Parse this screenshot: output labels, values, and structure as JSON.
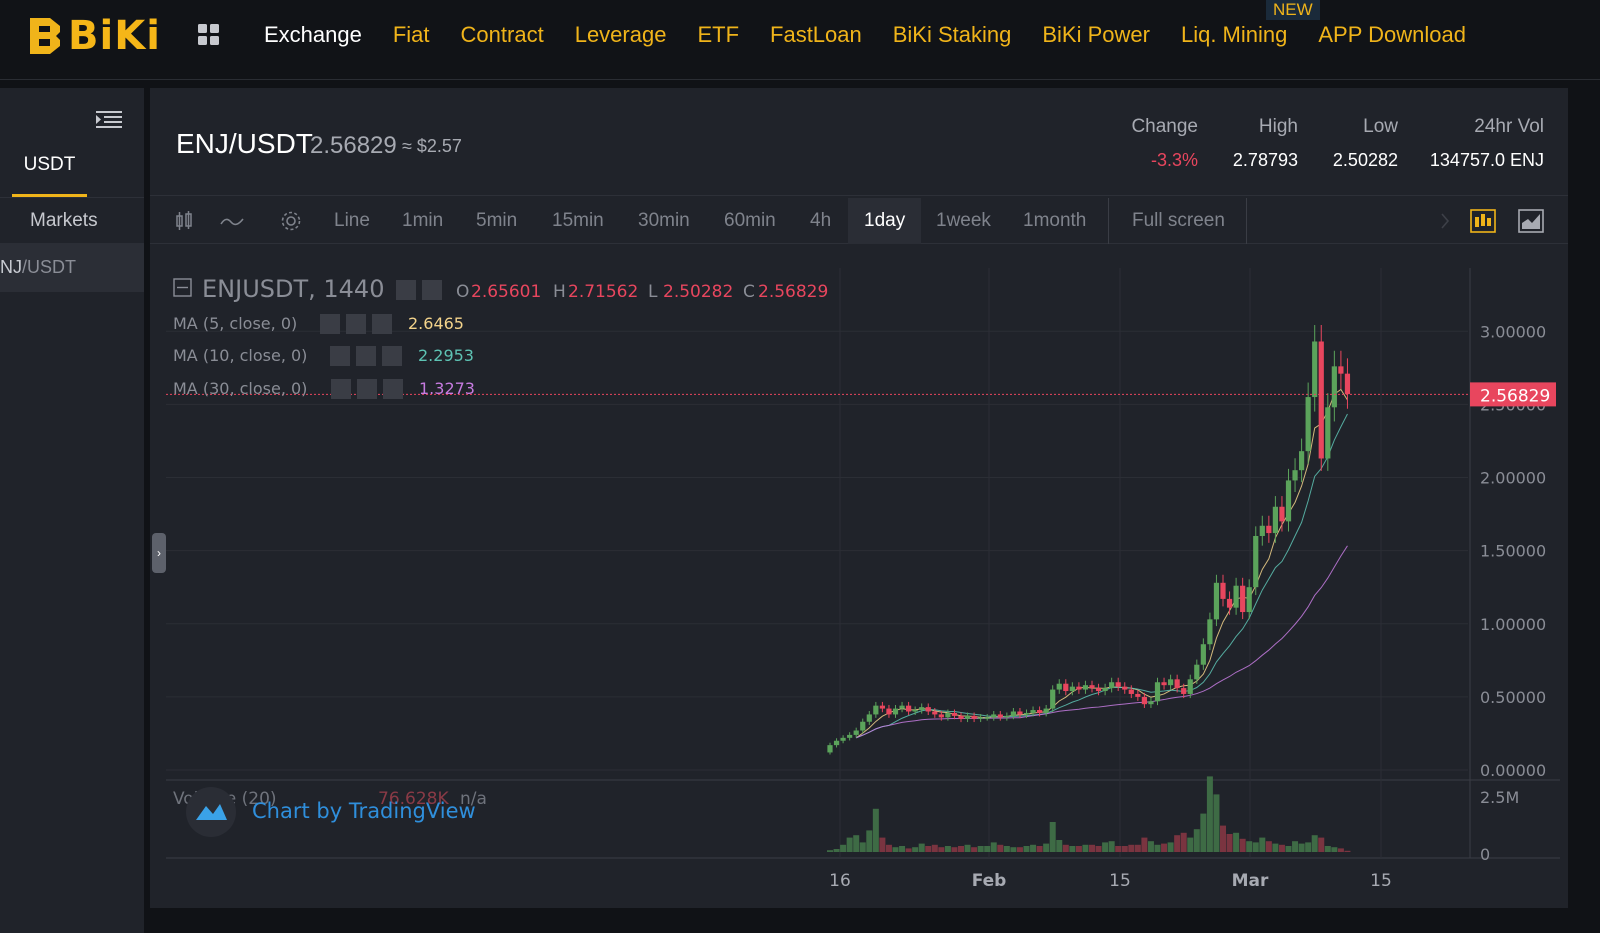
{
  "brand": {
    "name": "BiKi",
    "color": "#f0b41a"
  },
  "nav": {
    "items": [
      "Exchange",
      "Fiat",
      "Contract",
      "Leverage",
      "ETF",
      "FastLoan",
      "BiKi Staking",
      "BiKi Power",
      "Liq. Mining",
      "APP Download"
    ],
    "active": "Exchange",
    "badge": "NEW"
  },
  "sidebar": {
    "tab": "USDT",
    "markets_label": "Markets",
    "pair_base": "NJ",
    "pair_quote": "/USDT"
  },
  "ticker": {
    "pair": "ENJ/USDT",
    "price": "2.56829",
    "usd": "≈ $2.57",
    "change_label": "Change",
    "change_value": "-3.3%",
    "high_label": "High",
    "high_value": "2.78793",
    "low_label": "Low",
    "low_value": "2.50282",
    "vol_label": "24hr Vol",
    "vol_value": "134757.0 ENJ"
  },
  "toolbar": {
    "intervals": [
      "Line",
      "1min",
      "5min",
      "15min",
      "30min",
      "60min",
      "4h",
      "1day",
      "1week",
      "1month"
    ],
    "active": "1day",
    "fullscreen": "Full screen"
  },
  "legend": {
    "symbol": "ENJUSDT, 1440",
    "o_label": "O",
    "o": "2.65601",
    "h_label": "H",
    "h": "2.71562",
    "l_label": "L",
    "l": "2.50282",
    "c_label": "C",
    "c": "2.56829",
    "ma5_label": "MA (5, close, 0)",
    "ma5": "2.6465",
    "ma10_label": "MA (10, close, 0)",
    "ma10": "2.2953",
    "ma30_label": "MA (30, close, 0)",
    "ma30": "1.3273",
    "volume_label": "Volume (20)",
    "volume": "76.628K",
    "volume_na": "n/a",
    "credit": "Chart by TradingView"
  },
  "colors": {
    "up": "#5ba35b",
    "down": "#e8465e",
    "ma5": "#f3d38b",
    "ma10": "#5ec3b4",
    "ma30": "#c67be0",
    "grid": "#2b2e35"
  },
  "chart_data": {
    "type": "candlestick",
    "y_ticks": [
      "3.00000",
      "2.50000",
      "2.00000",
      "1.50000",
      "1.00000",
      "0.50000",
      "0.00000"
    ],
    "ylim": [
      0,
      3.2
    ],
    "last_price_label": "2.56829",
    "x_ticks": [
      "16",
      "Feb",
      "15",
      "Mar",
      "15"
    ],
    "volume_ticks": [
      "2.5M",
      "0"
    ],
    "closes": [
      0.17,
      0.2,
      0.22,
      0.24,
      0.27,
      0.33,
      0.38,
      0.44,
      0.42,
      0.38,
      0.42,
      0.44,
      0.4,
      0.41,
      0.43,
      0.4,
      0.38,
      0.36,
      0.39,
      0.37,
      0.35,
      0.37,
      0.35,
      0.36,
      0.36,
      0.38,
      0.36,
      0.37,
      0.4,
      0.38,
      0.39,
      0.41,
      0.39,
      0.42,
      0.55,
      0.59,
      0.54,
      0.57,
      0.55,
      0.58,
      0.56,
      0.54,
      0.56,
      0.6,
      0.57,
      0.55,
      0.52,
      0.5,
      0.45,
      0.47,
      0.6,
      0.58,
      0.62,
      0.56,
      0.52,
      0.62,
      0.72,
      0.86,
      1.03,
      1.28,
      1.17,
      1.11,
      1.26,
      1.08,
      1.25,
      1.6,
      1.67,
      1.62,
      1.8,
      1.7,
      1.98,
      2.05,
      2.18,
      2.55,
      2.93,
      2.13,
      2.48,
      2.76,
      2.71,
      2.57
    ],
    "volumes": [
      0.15,
      0.25,
      0.6,
      1.2,
      1.4,
      0.8,
      1.8,
      3.6,
      1.2,
      0.6,
      0.4,
      0.5,
      0.3,
      0.4,
      0.7,
      0.5,
      0.6,
      0.4,
      0.5,
      0.4,
      0.5,
      0.6,
      0.4,
      0.5,
      0.5,
      0.8,
      0.6,
      0.5,
      0.4,
      0.4,
      0.5,
      0.6,
      0.5,
      0.7,
      2.5,
      1.0,
      0.6,
      0.5,
      0.5,
      0.6,
      0.6,
      0.5,
      0.8,
      0.9,
      0.5,
      0.5,
      0.6,
      0.6,
      1.2,
      0.9,
      0.6,
      0.7,
      0.8,
      1.4,
      1.6,
      1.2,
      1.9,
      3.2,
      6.3,
      4.8,
      2.2,
      1.5,
      1.6,
      1.1,
      0.9,
      0.8,
      1.2,
      0.9,
      0.7,
      0.6,
      0.5,
      0.9,
      0.7,
      0.8,
      1.4,
      1.2,
      0.5,
      0.4,
      0.3,
      0.1
    ]
  }
}
